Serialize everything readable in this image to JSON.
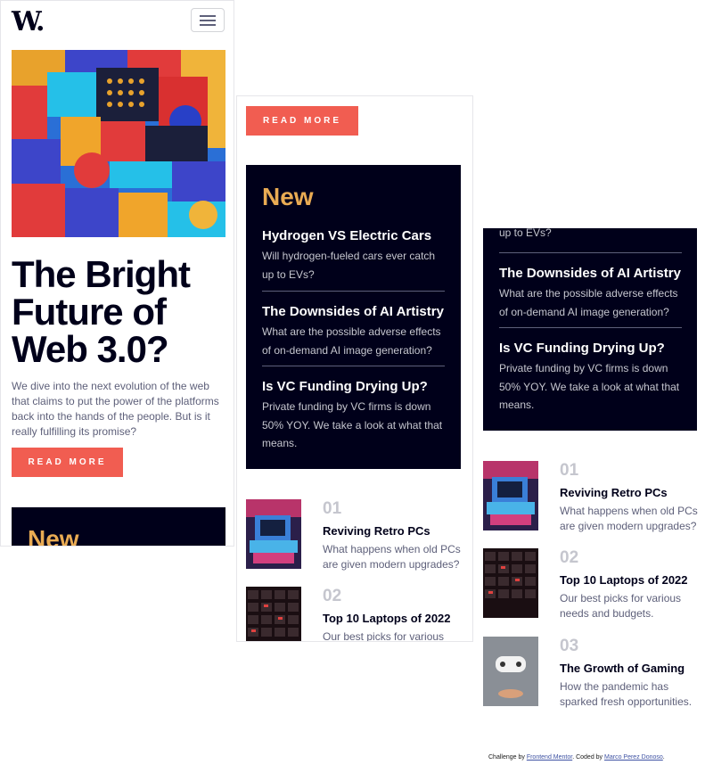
{
  "header": {
    "logo": "W.",
    "menu_icon": "hamburger-menu-icon"
  },
  "hero": {
    "headline": "The Bright Future of Web 3.0?",
    "intro": "We dive into the next evolution of the web that claims to put the power of the platforms back into the hands of the people. But is it really fulfilling its promise?",
    "button_label": "READ MORE"
  },
  "new_section": {
    "title": "New",
    "items": [
      {
        "title": "Hydrogen VS Electric Cars",
        "desc": "Will hydrogen-fueled cars ever catch up to EVs?"
      },
      {
        "title": "The Downsides of AI Artistry",
        "desc": "What are the possible adverse effects of on-demand AI image generation?"
      },
      {
        "title": "Is VC Funding Drying Up?",
        "desc": "Private funding by VC firms is down 50% YOY. We take a look at what that means."
      }
    ],
    "partial_text": "up to EVs?"
  },
  "top_articles": [
    {
      "num": "01",
      "title": "Reviving Retro PCs",
      "desc": "What happens when old PCs are given modern upgrades?"
    },
    {
      "num": "02",
      "title": "Top 10 Laptops of 2022",
      "desc": "Our best picks for various needs and budgets."
    },
    {
      "num": "03",
      "title": "The Growth of Gaming",
      "desc": "How the pandemic has sparked fresh opportunities."
    }
  ],
  "footer": {
    "prefix": "Challenge by",
    "link1": "Frontend Mentor",
    "middle": ". Coded by",
    "link2": "Marco Perez Donoso",
    "suffix": "."
  },
  "colors": {
    "accent": "#f15d51",
    "dark": "#00001a",
    "gold": "#e9ab53",
    "muted": "#5e607a"
  }
}
